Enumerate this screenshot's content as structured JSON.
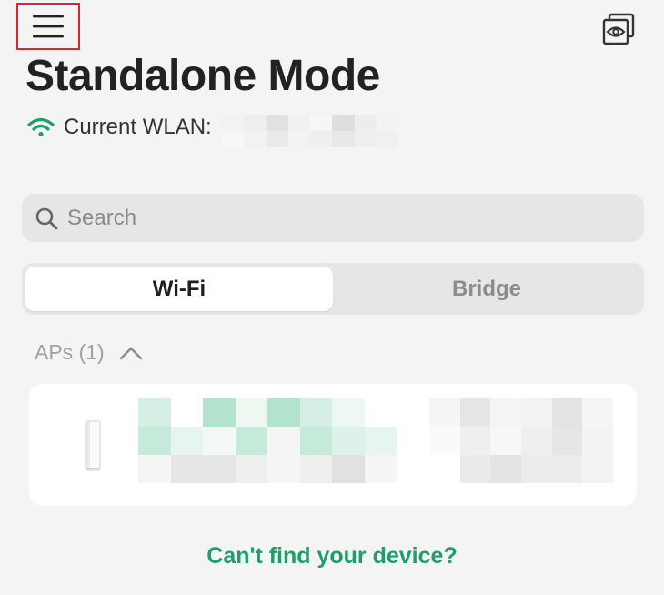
{
  "header": {
    "menu_icon": "hamburger-menu-icon",
    "view_icon": "eye-view-icon",
    "title": "Standalone Mode"
  },
  "wlan": {
    "label": "Current WLAN:",
    "icon": "wifi-icon",
    "icon_color": "#1e9e69"
  },
  "search": {
    "placeholder": "Search",
    "icon": "search-icon"
  },
  "tabs": [
    {
      "label": "Wi-Fi",
      "active": true
    },
    {
      "label": "Bridge",
      "active": false
    }
  ],
  "section": {
    "label": "APs (1)",
    "icon": "chevron-up-icon"
  },
  "device_card": {
    "icon": "access-point-device-icon"
  },
  "footer": {
    "help_link": "Can't find your device?"
  },
  "colors": {
    "accent": "#1e9e69",
    "highlight_box": "#d9262f"
  }
}
